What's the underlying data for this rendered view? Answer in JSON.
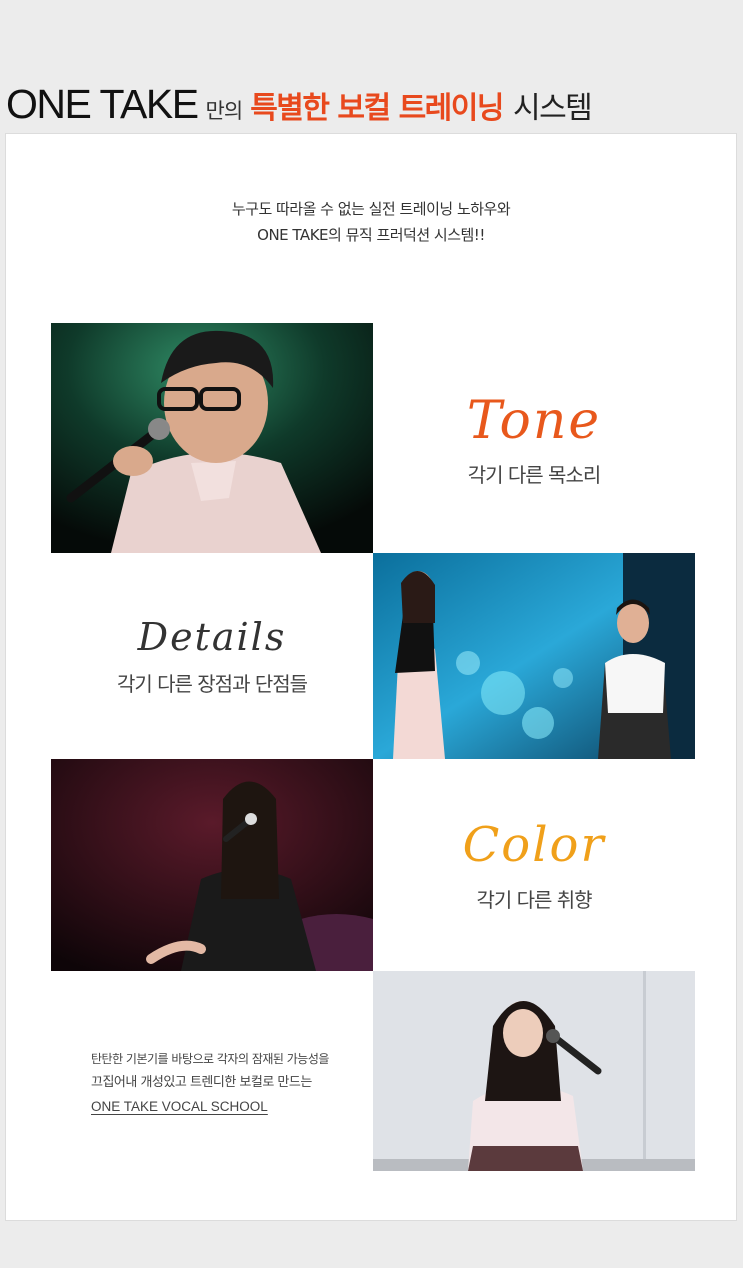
{
  "header": {
    "brand": "ONE TAKE",
    "small": "만의",
    "accent": "특별한 보컬 트레이닝",
    "tail": "시스템",
    "accent_color": "#e8491d"
  },
  "intro": {
    "line1": "누구도 따라올 수 없는 실전 트레이닝 노하우와",
    "line2": "ONE TAKE의 뮤직 프러덕션 시스템!!"
  },
  "sections": {
    "tone": {
      "title": "Tone",
      "subtitle": "각기 다른 목소리",
      "color": "#e8581c"
    },
    "details": {
      "title": "Details",
      "subtitle": "각기 다른 장점과 단점들",
      "color": "#333333"
    },
    "color": {
      "title": "Color",
      "subtitle": "각기 다른 취향",
      "color": "#f0a01a"
    }
  },
  "closing": {
    "line1": "탄탄한 기본기를 바탕으로 각자의 잠재된 가능성을",
    "line2": "끄집어내 개성있고 트렌디한 보컬로 만드는",
    "line3": "ONE TAKE VOCAL SCHOOL"
  },
  "photos": {
    "photo1": "male singer with glasses holding microphone under green stage light",
    "photo2": "duet singers on stage with blue bokeh lights",
    "photo3": "female singer seated with microphone under pink light",
    "photo4": "female student singing with microphone in bright room"
  }
}
